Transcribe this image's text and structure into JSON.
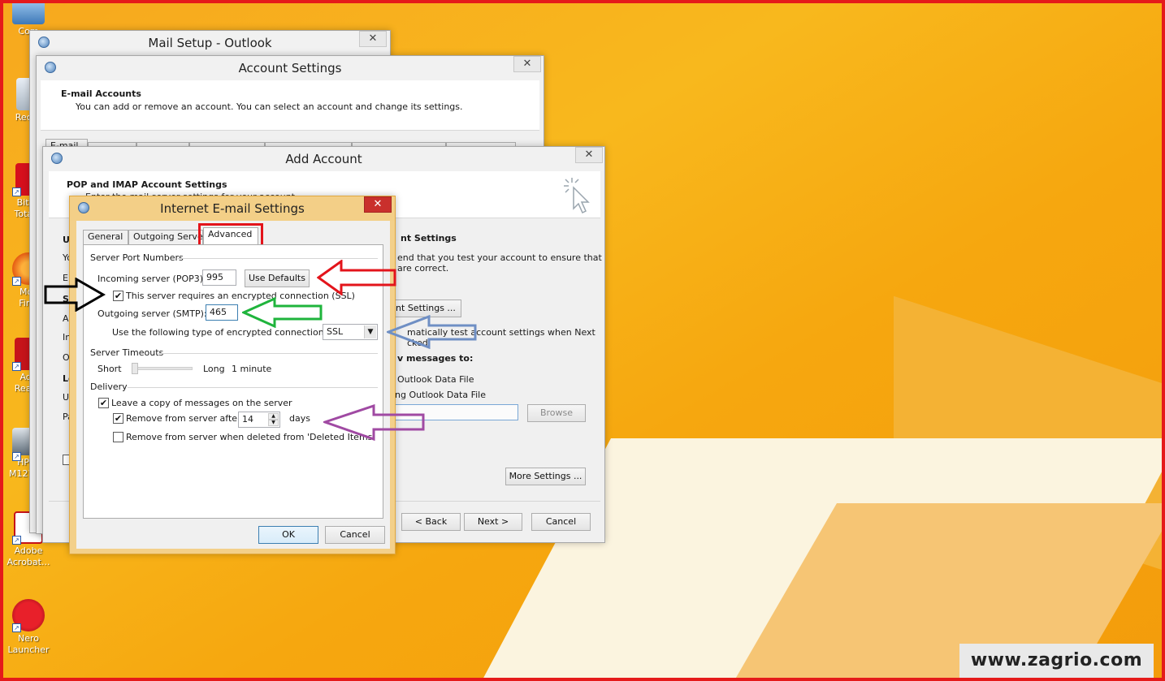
{
  "desktop": {
    "icons": [
      {
        "label": "Com"
      },
      {
        "label": "Recyc"
      },
      {
        "label": "Bitde\nTotal s"
      },
      {
        "label": "Moz\nFiref"
      },
      {
        "label": "Ado\nReade"
      },
      {
        "label": "HP LJ\nM1271..."
      },
      {
        "label": "Adobe\nAcrobat..."
      },
      {
        "label": "Nero\nLauncher"
      }
    ],
    "watermark": "www.zagrio.com"
  },
  "mail_setup": {
    "title": "Mail Setup - Outlook",
    "close": "✕"
  },
  "account_settings": {
    "title": "Account Settings",
    "close": "✕",
    "heading": "E-mail Accounts",
    "subtitle": "You can add or remove an account. You can select an account and change its settings.",
    "first_tab": "E-mail"
  },
  "add_account": {
    "title": "Add Account",
    "close": "✕",
    "heading": "POP and IMAP Account Settings",
    "subheading": "Enter the mail server settings for your account.",
    "left_letters": [
      "U",
      "Yo",
      "Er",
      "Se",
      "A",
      "In",
      "O",
      "Lo",
      "U",
      "Pa"
    ],
    "test_heading": "nt Settings",
    "test_line1": "end that you test your account to ensure that",
    "test_line2": "are correct.",
    "test_button": "unt Settings ...",
    "auto_test_line1": "matically test account settings when Next",
    "auto_test_line2": "cked",
    "deliver_heading": "v messages to:",
    "option_new": "Outlook Data File",
    "option_existing": "ing Outlook Data File",
    "browse_button": "Browse",
    "more_settings_button": "More Settings ...",
    "back_button": "< Back",
    "next_button": "Next >",
    "cancel_button": "Cancel"
  },
  "internet_email": {
    "title": "Internet E-mail Settings",
    "close": "✕",
    "tabs": [
      "General",
      "Outgoing Serve",
      "Advanced"
    ],
    "active_tab": "Advanced",
    "server_ports_label": "Server Port Numbers",
    "incoming_label": "Incoming server (POP3):",
    "incoming_value": "995",
    "use_defaults_button": "Use Defaults",
    "ssl_checkbox_label": "This server requires an encrypted connection (SSL)",
    "ssl_checked": true,
    "outgoing_label": "Outgoing server (SMTP):",
    "outgoing_value": "465",
    "encryption_label": "Use the following type of encrypted connection:",
    "encryption_value": "SSL",
    "timeouts_label": "Server Timeouts",
    "timeout_short": "Short",
    "timeout_long": "Long",
    "timeout_value": "1 minute",
    "timeout_fraction": 0.0,
    "delivery_label": "Delivery",
    "leave_copy_label": "Leave a copy of messages on the server",
    "leave_copy_checked": true,
    "remove_after_label": "Remove from server after",
    "remove_after_checked": true,
    "remove_after_days": "14",
    "days_label": "days",
    "remove_deleted_label": "Remove from server when deleted from 'Deleted Items'",
    "remove_deleted_checked": false,
    "ok_button": "OK",
    "cancel_button": "Cancel"
  },
  "annotations": {
    "colors": {
      "advanced_box": "#e3141b",
      "red_arrow": "#e3141b",
      "black_arrow": "#000000",
      "green_arrow": "#1fb43c",
      "blue_arrow": "#6f8fc4",
      "purple_arrow": "#a04aa3"
    }
  }
}
